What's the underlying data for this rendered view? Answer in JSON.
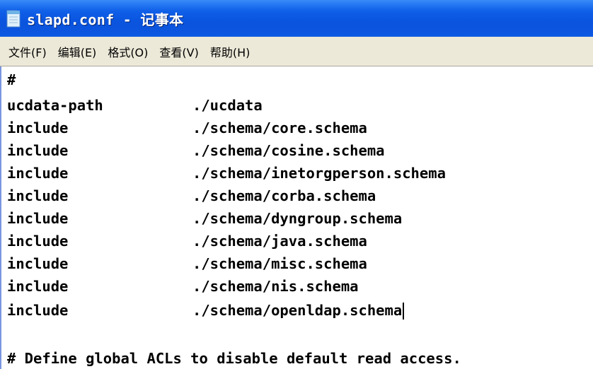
{
  "window": {
    "title": "slapd.conf - 记事本",
    "accent": "#0a54de"
  },
  "menu": {
    "items": [
      "文件(F)",
      "编辑(E)",
      "格式(O)",
      "查看(V)",
      "帮助(H)"
    ]
  },
  "editor": {
    "lines": [
      {
        "kw": "#",
        "val": ""
      },
      {
        "kw": "ucdata-path",
        "val": "./ucdata"
      },
      {
        "kw": "include",
        "val": "./schema/core.schema"
      },
      {
        "kw": "include",
        "val": "./schema/cosine.schema"
      },
      {
        "kw": "include",
        "val": "./schema/inetorgperson.schema"
      },
      {
        "kw": "include",
        "val": "./schema/corba.schema"
      },
      {
        "kw": "include",
        "val": "./schema/dyngroup.schema"
      },
      {
        "kw": "include",
        "val": "./schema/java.schema"
      },
      {
        "kw": "include",
        "val": "./schema/misc.schema"
      },
      {
        "kw": "include",
        "val": "./schema/nis.schema"
      },
      {
        "kw": "include",
        "val": "./schema/openldap.schema"
      },
      {
        "kw": "",
        "val": ""
      },
      {
        "kw": "",
        "val": ""
      },
      {
        "kw": "# Define global ACLs to disable default read access.",
        "val": ""
      }
    ]
  }
}
